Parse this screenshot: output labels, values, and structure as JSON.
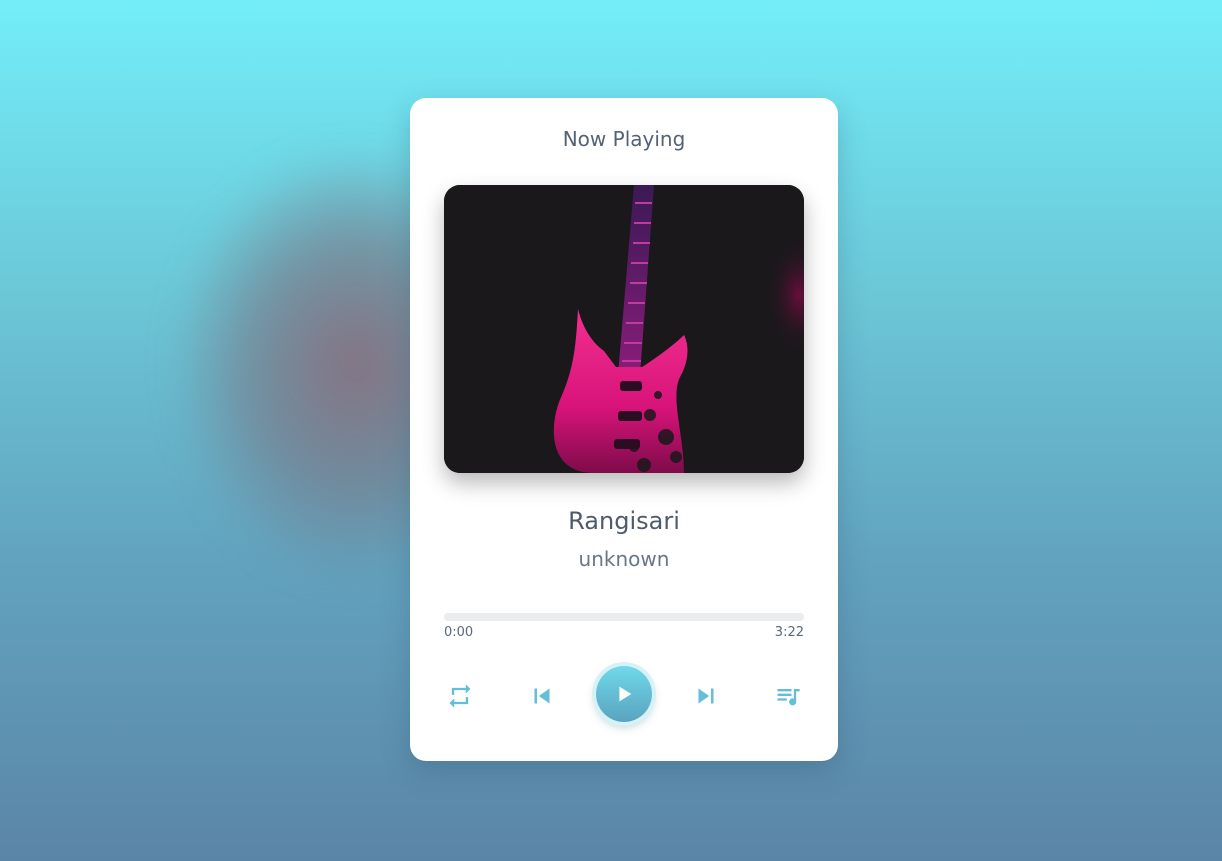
{
  "header": {
    "title": "Now Playing"
  },
  "track": {
    "title": "Rangisari",
    "artist": "unknown",
    "cover_icon": "guitar-album-art"
  },
  "progress": {
    "current_time": "0:00",
    "total_time": "3:22",
    "fraction": 0
  },
  "controls": {
    "repeat_icon": "repeat-icon",
    "previous_icon": "skip-previous-icon",
    "play_icon": "play-icon",
    "next_icon": "skip-next-icon",
    "playlist_icon": "playlist-icon"
  },
  "colors": {
    "accent": "#62bfd5",
    "background_top": "#73eef9",
    "background_bottom": "#5b85a6",
    "card": "#ffffff",
    "cover_bg": "#1a181b",
    "guitar_pink": "#e0147a"
  }
}
